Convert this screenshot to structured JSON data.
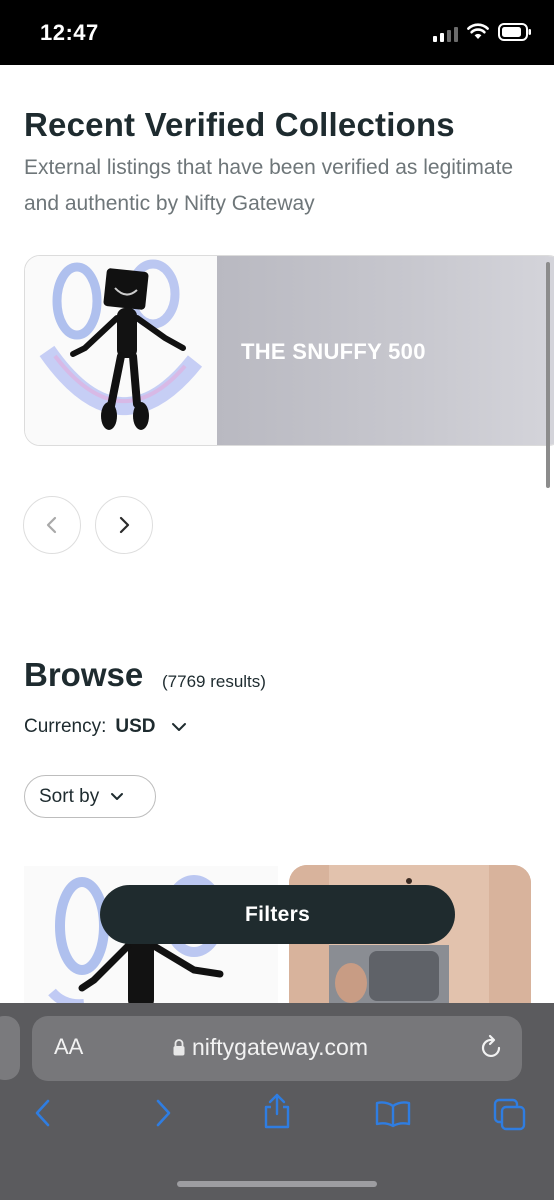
{
  "status_bar": {
    "time": "12:47"
  },
  "verified": {
    "title": "Recent Verified Collections",
    "subtitle": "External listings that have been verified as legitimate and authentic by Nifty Gateway",
    "card": {
      "title": "THE SNUFFY 500"
    }
  },
  "browse": {
    "title": "Browse",
    "results": "(7769 results)",
    "currency_label": "Currency:",
    "currency_value": "USD",
    "sort_label": "Sort by",
    "filters_label": "Filters"
  },
  "safari": {
    "text_size_label": "AA",
    "url": "niftygateway.com"
  },
  "colors": {
    "text_dark": "#1e2b2f",
    "text_muted": "#6e7679",
    "filters_bg": "#1f2b2e",
    "ios_blue": "#2f7de1"
  },
  "icons": [
    "signal-icon",
    "wifi-icon",
    "battery-icon",
    "chevron-left-icon",
    "chevron-right-icon",
    "chevron-down-icon",
    "lock-icon",
    "reload-icon",
    "back-icon",
    "forward-icon",
    "share-icon",
    "bookmarks-icon",
    "tabs-icon"
  ]
}
